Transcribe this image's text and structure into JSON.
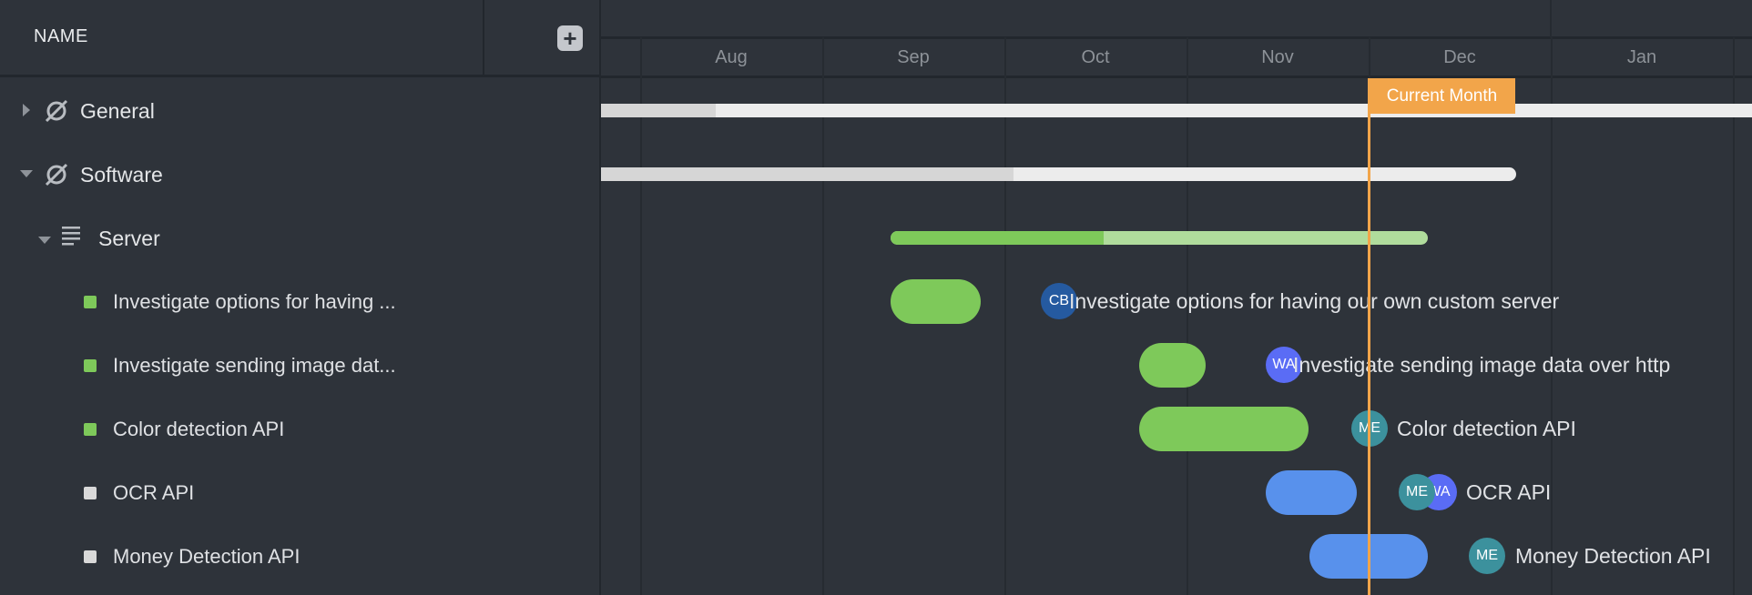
{
  "header": {
    "name_column": "NAME",
    "add_button": "+"
  },
  "timeline": {
    "months": [
      "Aug",
      "Sep",
      "Oct",
      "Nov",
      "Dec",
      "Jan"
    ],
    "current_month_label": "Current Month"
  },
  "tree": [
    {
      "label": "General",
      "icon": "planet-icon",
      "expanded": false,
      "progress": 0.1
    },
    {
      "label": "Software",
      "icon": "planet-icon",
      "expanded": true,
      "progress": 0.45
    },
    {
      "label": "Server",
      "icon": "list-icon",
      "expanded": true,
      "progress": 0.4
    }
  ],
  "tasks": [
    {
      "short": "Investigate options for having ...",
      "full": "Investigate options for having our own custom server",
      "assignees": [
        "CB"
      ],
      "status_color": "#7ec95a"
    },
    {
      "short": "Investigate sending image dat...",
      "full": "Investigate sending image data over http",
      "assignees": [
        "WA"
      ],
      "status_color": "#7ec95a"
    },
    {
      "short": "Color detection API",
      "full": "Color detection API",
      "assignees": [
        "ME"
      ],
      "status_color": "#7ec95a"
    },
    {
      "short": "OCR API",
      "full": "OCR API",
      "assignees": [
        "ME",
        "WA"
      ],
      "status_color": "#d9d9d9"
    },
    {
      "short": "Money Detection API",
      "full": "Money Detection API",
      "assignees": [
        "ME"
      ],
      "status_color": "#d9d9d9"
    }
  ],
  "colors": {
    "green": "#7ec95a",
    "light_green": "#b0dc9c",
    "blue": "#5891ec",
    "orange": "#f2a54a",
    "CB": "#255aa0",
    "WA": "#5a6cf5",
    "ME": "#3c919d"
  }
}
